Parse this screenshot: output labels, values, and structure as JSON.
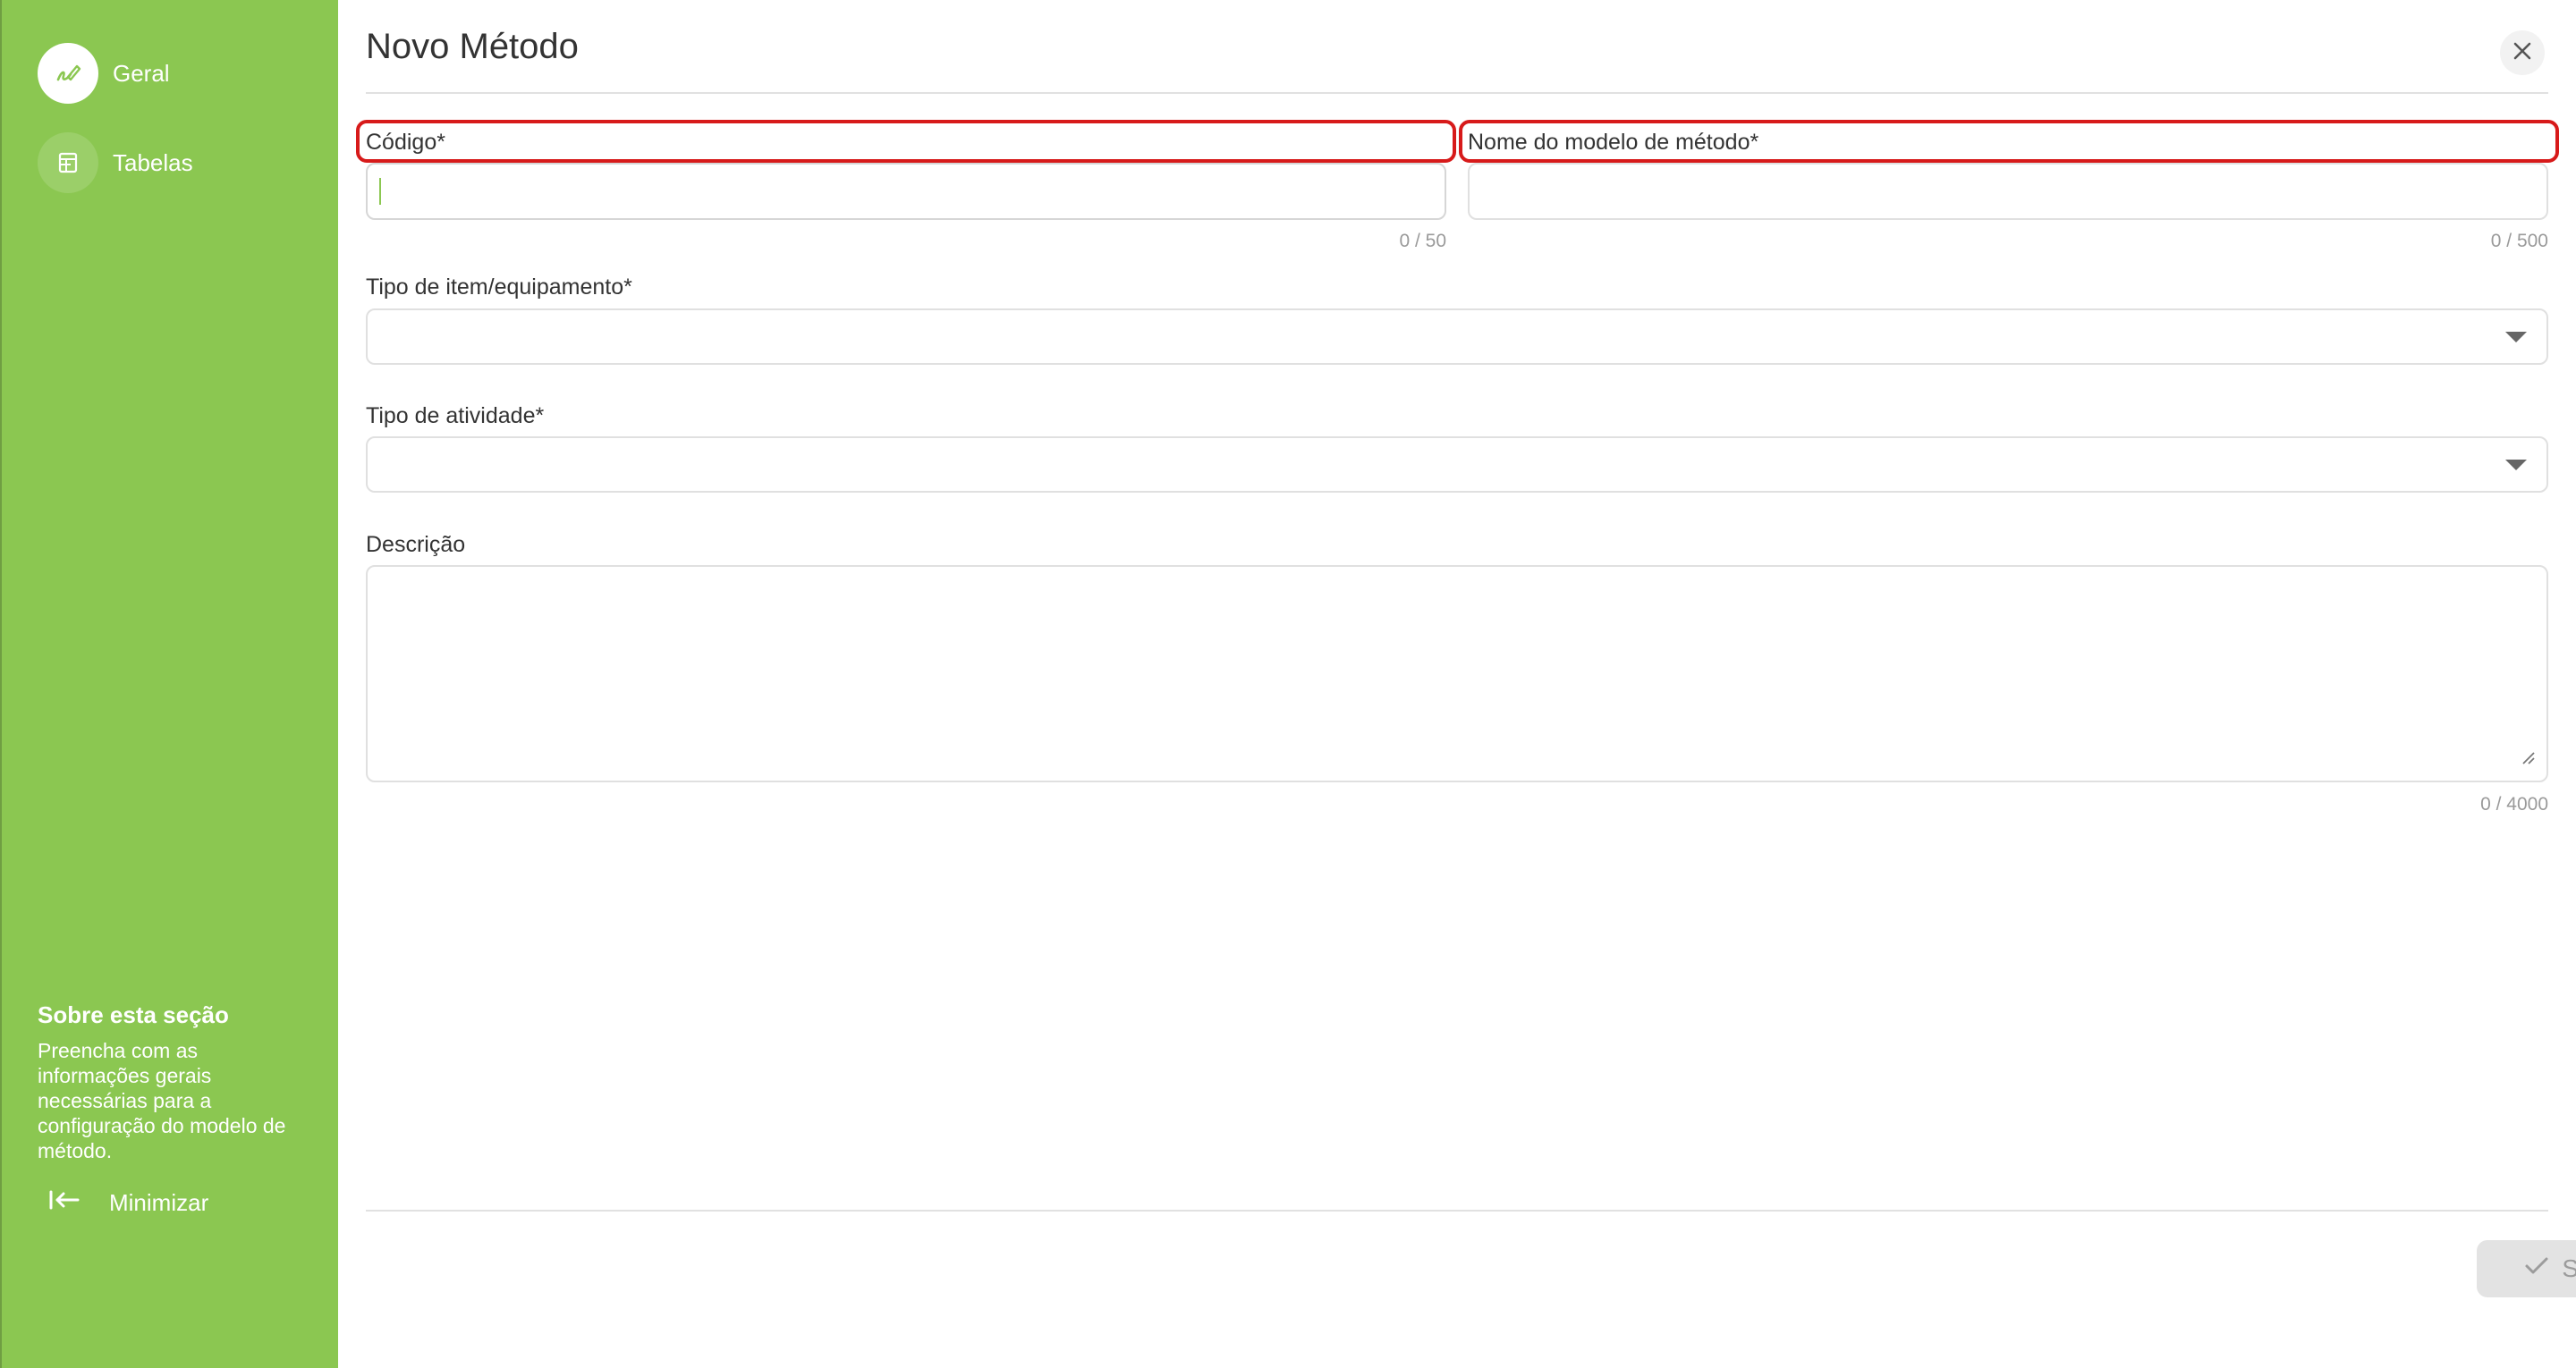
{
  "sidebar": {
    "items": [
      {
        "label": "Geral",
        "icon": "pen-icon",
        "active": true
      },
      {
        "label": "Tabelas",
        "icon": "table-list-icon",
        "active": false
      }
    ],
    "about_title": "Sobre esta seção",
    "about_text": "Preencha com as informações gerais necessárias para a configuração do modelo de método.",
    "minimize_label": "Minimizar"
  },
  "header": {
    "title": "Novo Método"
  },
  "form": {
    "codigo": {
      "label": "Código*",
      "value": "",
      "counter": "0 / 50"
    },
    "nome": {
      "label": "Nome do modelo de método*",
      "value": "",
      "counter": "0 / 500"
    },
    "tipo_item": {
      "label": "Tipo de item/equipamento*",
      "value": ""
    },
    "tipo_atividade": {
      "label": "Tipo de atividade*",
      "value": ""
    },
    "descricao": {
      "label": "Descrição",
      "value": "",
      "counter": "0 / 4000"
    }
  },
  "footer": {
    "save_label": "Salvar"
  },
  "colors": {
    "sidebar": "#8bc751",
    "highlight": "#d71a1a",
    "disabled_button": "#e3e3e3"
  }
}
